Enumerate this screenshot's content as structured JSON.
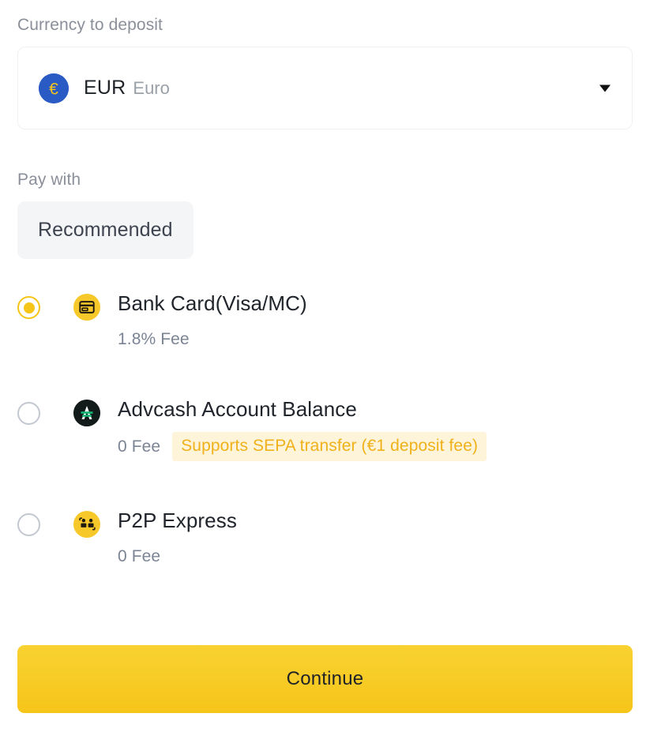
{
  "currency_section": {
    "label": "Currency to deposit",
    "selected": {
      "code": "EUR",
      "name": "Euro",
      "symbol": "€",
      "icon": "eur-coin-icon",
      "icon_bg": "#2a5bc4",
      "icon_fg": "#f5c518"
    },
    "caret_icon": "chevron-down-icon"
  },
  "paywith_section": {
    "label": "Pay with",
    "tabs": [
      {
        "label": "Recommended",
        "active": true
      }
    ],
    "methods": [
      {
        "id": "bank-card",
        "title": "Bank Card(Visa/MC)",
        "fee": "1.8% Fee",
        "selected": true,
        "icon": "credit-card-icon",
        "icon_bg": "#f7c82a",
        "badge": null
      },
      {
        "id": "advcash",
        "title": "Advcash Account Balance",
        "fee": "0 Fee",
        "selected": false,
        "icon": "advcash-logo-icon",
        "icon_bg": "#121b1a",
        "badge": "Supports SEPA transfer (€1 deposit fee)"
      },
      {
        "id": "p2p-express",
        "title": "P2P Express",
        "fee": "0 Fee",
        "selected": false,
        "icon": "p2p-people-icon",
        "icon_bg": "#f7c82a",
        "badge": null
      }
    ]
  },
  "footer": {
    "continue_label": "Continue",
    "accent_color": "#f6c51a"
  }
}
